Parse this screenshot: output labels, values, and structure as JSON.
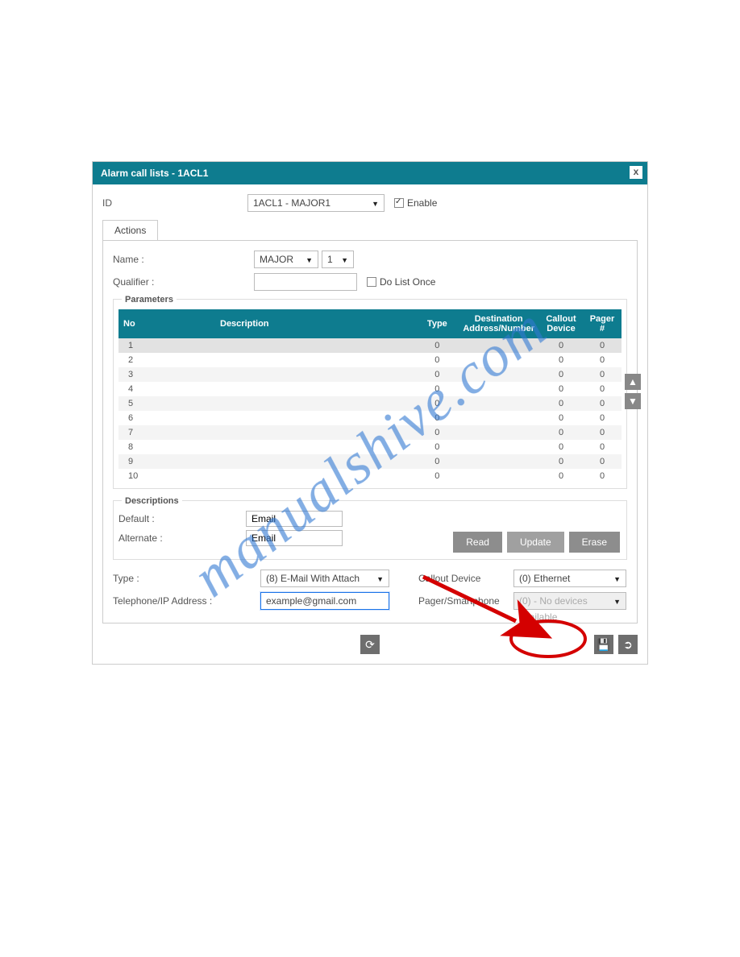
{
  "watermark": "manualshive.com",
  "title": "Alarm call lists - 1ACL1",
  "id_label": "ID",
  "id_select": "1ACL1 - MAJOR1",
  "enable_label": "Enable",
  "enable_checked": true,
  "tab": "Actions",
  "name_label": "Name :",
  "name_select1": "MAJOR",
  "name_select2": "1",
  "qualifier_label": "Qualifier :",
  "qualifier_value": "",
  "do_list_once": "Do List Once",
  "params_title": "Parameters",
  "headers": {
    "no": "No",
    "desc": "Description",
    "type": "Type",
    "dest": "Destination Address/Number",
    "call": "Callout Device",
    "pager": "Pager #"
  },
  "rows": [
    {
      "no": "1",
      "desc": "",
      "type": "0",
      "dest": "",
      "call": "0",
      "pager": "0",
      "selected": true
    },
    {
      "no": "2",
      "desc": "",
      "type": "0",
      "dest": "",
      "call": "0",
      "pager": "0"
    },
    {
      "no": "3",
      "desc": "",
      "type": "0",
      "dest": "",
      "call": "0",
      "pager": "0"
    },
    {
      "no": "4",
      "desc": "",
      "type": "0",
      "dest": "",
      "call": "0",
      "pager": "0"
    },
    {
      "no": "5",
      "desc": "",
      "type": "0",
      "dest": "",
      "call": "0",
      "pager": "0"
    },
    {
      "no": "6",
      "desc": "",
      "type": "0",
      "dest": "",
      "call": "0",
      "pager": "0"
    },
    {
      "no": "7",
      "desc": "",
      "type": "0",
      "dest": "",
      "call": "0",
      "pager": "0"
    },
    {
      "no": "8",
      "desc": "",
      "type": "0",
      "dest": "",
      "call": "0",
      "pager": "0"
    },
    {
      "no": "9",
      "desc": "",
      "type": "0",
      "dest": "",
      "call": "0",
      "pager": "0"
    },
    {
      "no": "10",
      "desc": "",
      "type": "0",
      "dest": "",
      "call": "0",
      "pager": "0"
    }
  ],
  "descs_title": "Descriptions",
  "default_label": "Default :",
  "default_value": "Email",
  "alternate_label": "Alternate :",
  "alternate_value": "Email",
  "btn_read": "Read",
  "btn_update": "Update",
  "btn_erase": "Erase",
  "type_label": "Type :",
  "type_value": "(8) E-Mail With Attach",
  "tel_label": "Telephone/IP Address :",
  "tel_value": "example@gmail.com",
  "callout_label": "Callout Device",
  "callout_value": "(0) Ethernet",
  "pager_label": "Pager/Smartphone",
  "pager_value": "(0) - No devices available"
}
